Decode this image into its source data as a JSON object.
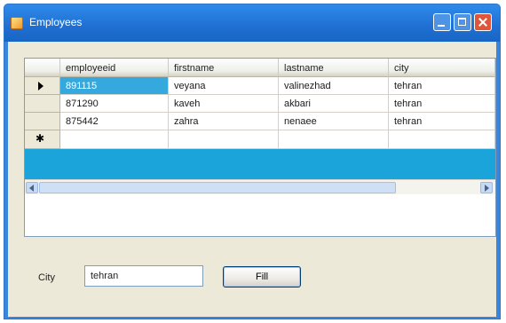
{
  "window": {
    "title": "Employees"
  },
  "grid": {
    "columns": [
      "employeeid",
      "firstname",
      "lastname",
      "city"
    ],
    "rows": [
      {
        "employeeid": "891115",
        "firstname": "veyana",
        "lastname": "valinezhad",
        "city": "tehran"
      },
      {
        "employeeid": "871290",
        "firstname": "kaveh",
        "lastname": "akbari",
        "city": "tehran"
      },
      {
        "employeeid": "875442",
        "firstname": "zahra",
        "lastname": "nenaee",
        "city": "tehran"
      }
    ],
    "selected_row": 0,
    "selected_column": "employeeid",
    "selection_color": "#35a9de"
  },
  "filter": {
    "city_label": "City",
    "city_value": "tehran",
    "button_label": "Fill"
  },
  "colors": {
    "title_bar": "#1f6fd2",
    "form_background": "#ece9d8",
    "close_button": "#e0563a"
  }
}
